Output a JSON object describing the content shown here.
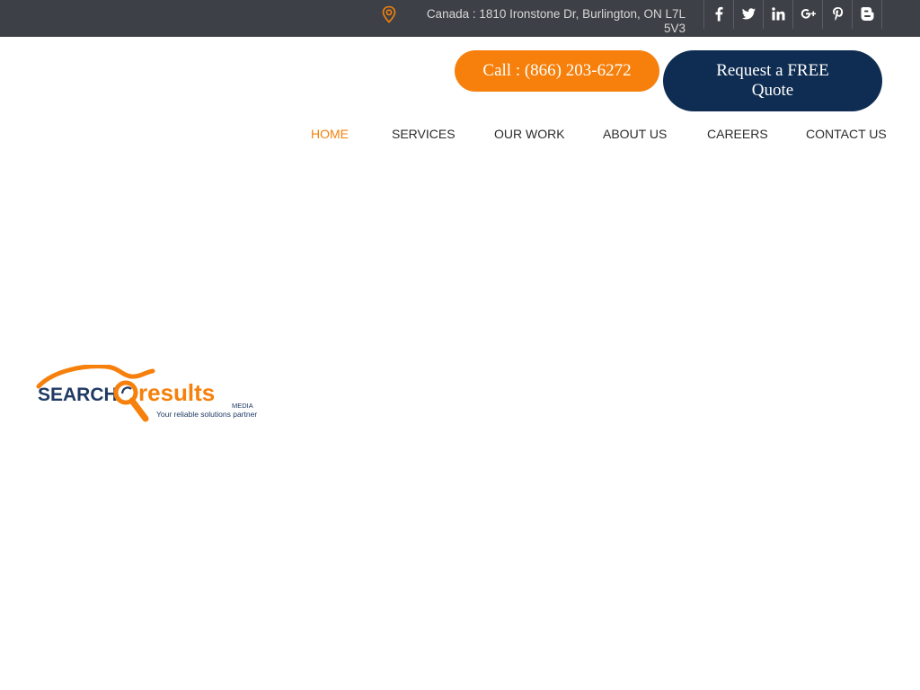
{
  "topbar": {
    "address": "Canada : 1810 Ironstone Dr, Burlington, ON L7L 5V3",
    "location_icon": "map-pin-icon",
    "social": [
      {
        "name": "facebook-icon"
      },
      {
        "name": "twitter-icon"
      },
      {
        "name": "linkedin-icon"
      },
      {
        "name": "google-plus-icon"
      },
      {
        "name": "pinterest-icon"
      },
      {
        "name": "blogger-icon"
      }
    ]
  },
  "header": {
    "call_label": "Call : (866) 203-6272",
    "quote_label": "Request a FREE Quote"
  },
  "nav": {
    "items": [
      {
        "label": "HOME",
        "active": true
      },
      {
        "label": "SERVICES"
      },
      {
        "label": "OUR WORK"
      },
      {
        "label": "ABOUT US"
      },
      {
        "label": "CAREERS"
      },
      {
        "label": "CONTACT US"
      }
    ]
  },
  "logo": {
    "word_left": "SEARCH",
    "word_right": "results",
    "sub": "MEDIA",
    "tagline": "Your reliable solutions partner"
  },
  "colors": {
    "topbar": "#3d4147",
    "accent_orange": "#f6800b",
    "navy": "#0f2d52"
  }
}
